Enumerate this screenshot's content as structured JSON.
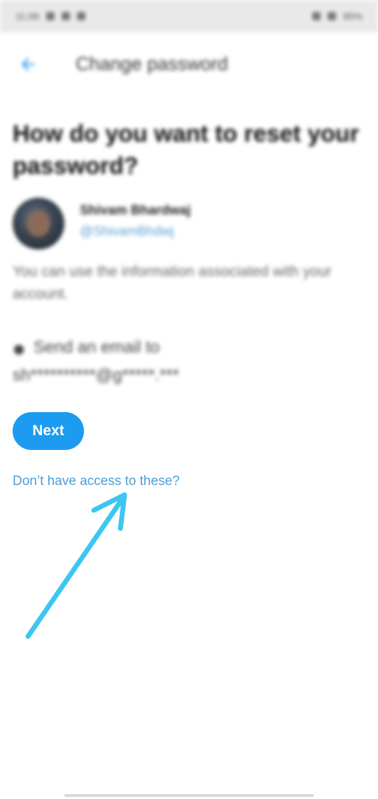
{
  "status_bar": {
    "time": "11:06",
    "battery": "95%"
  },
  "app_bar": {
    "back_icon": "arrow-left-icon",
    "title": "Change password"
  },
  "heading": "How do you want to reset your password?",
  "profile": {
    "name": "Shivam Bhardwaj",
    "handle": "@ShivamBhdwj"
  },
  "info_text": "You can use the information associated with your account.",
  "option": {
    "label": "Send an email to",
    "email": "sh**********@g*****.***"
  },
  "next_label": "Next",
  "help_link": "Don’t have access to these?",
  "colors": {
    "accent": "#1d9bf0",
    "link": "#4a9fd6",
    "annotation_arrow": "#3cc6f2"
  }
}
